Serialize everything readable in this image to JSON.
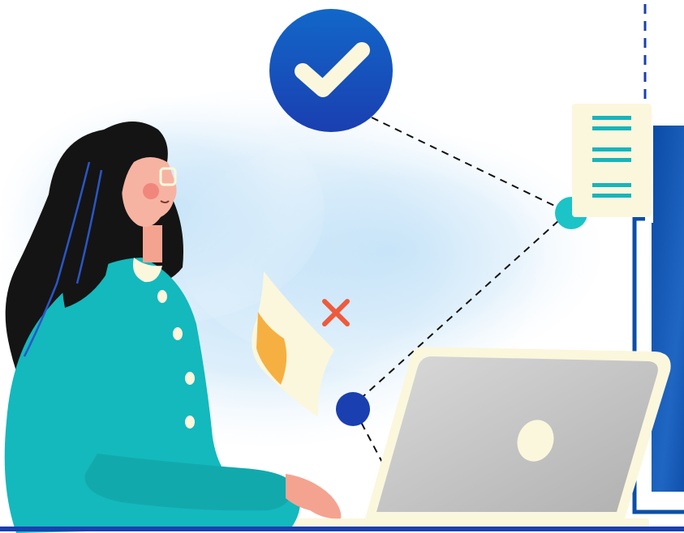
{
  "illustration": {
    "icons": {
      "check": "check-icon",
      "cross": "cross-icon",
      "document": "document-icon",
      "laptop": "laptop-icon"
    },
    "colors": {
      "primary_blue": "#0b4fa8",
      "deep_blue": "#1a3fb0",
      "teal": "#1cc3c7",
      "sweater_teal": "#13b9bd",
      "cream": "#fbf7dd",
      "hair": "#141414",
      "skin": "#f7b3a1",
      "cross_red": "#ef5a3c",
      "laptop_gray": "#c5c5c5",
      "paper_orange": "#f6b041"
    }
  }
}
